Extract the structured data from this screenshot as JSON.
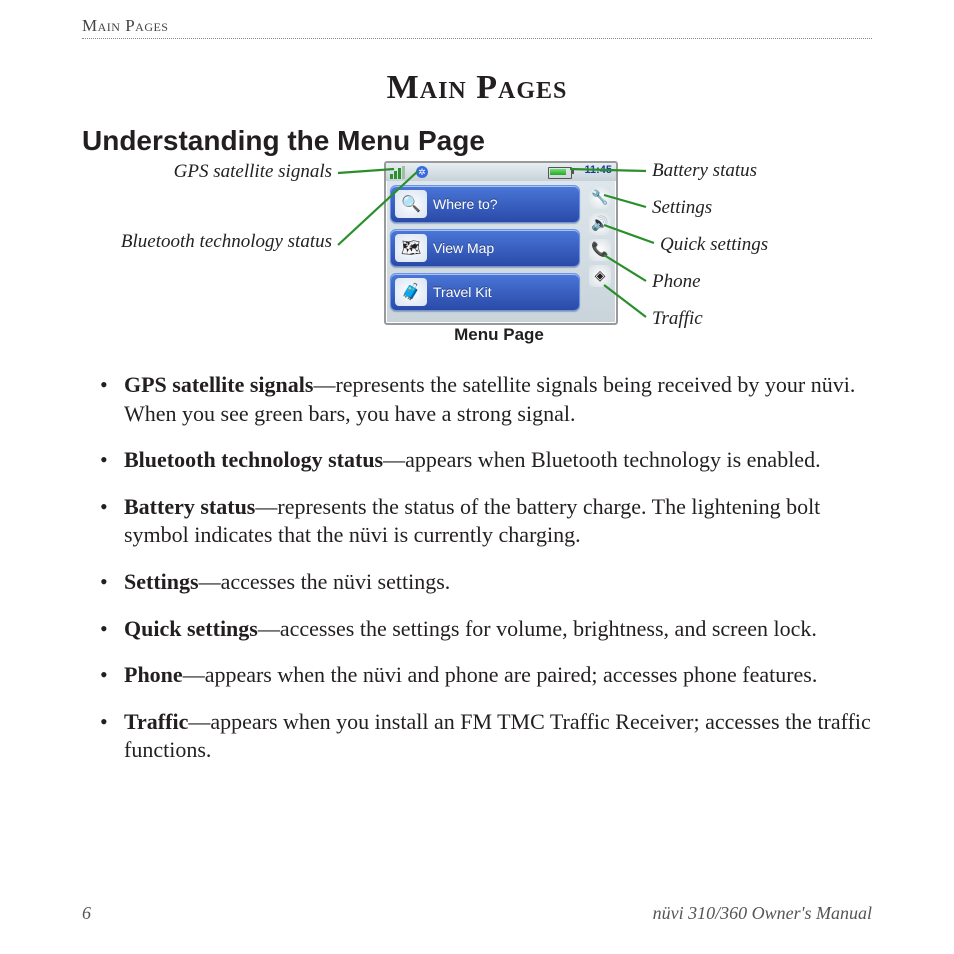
{
  "header": {
    "running_head": "Main Pages",
    "title": "Main Pages",
    "subtitle": "Understanding the Menu Page"
  },
  "footer": {
    "page_number": "6",
    "manual_title": "nüvi 310/360 Owner's Manual"
  },
  "diagram": {
    "caption": "Menu Page",
    "clock": "11:45",
    "buttons": [
      {
        "label": "Where to?"
      },
      {
        "label": "View Map"
      },
      {
        "label": "Travel Kit"
      }
    ],
    "callouts_left": [
      {
        "text": "GPS satellite signals"
      },
      {
        "text": "Bluetooth technology status"
      }
    ],
    "callouts_right": [
      {
        "text": "Battery status"
      },
      {
        "text": "Settings"
      },
      {
        "text": "Quick settings"
      },
      {
        "text": "Phone"
      },
      {
        "text": "Traffic"
      }
    ]
  },
  "definitions": [
    {
      "term": "GPS satellite signals",
      "dash": "—",
      "desc": "represents the satellite signals being received by your nüvi. When you see green bars, you have a strong signal."
    },
    {
      "term": "Bluetooth technology status",
      "dash": "—",
      "desc": "appears when Bluetooth technology is enabled."
    },
    {
      "term": "Battery status",
      "dash": "—",
      "desc": "represents the status of the battery charge. The lightening bolt symbol indicates that the nüvi is currently charging."
    },
    {
      "term": "Settings",
      "dash": "—",
      "desc": "accesses the nüvi settings."
    },
    {
      "term": "Quick settings",
      "dash": "—",
      "desc": "accesses the settings for volume, brightness, and screen lock."
    },
    {
      "term": "Phone",
      "dash": "—",
      "desc": "appears when the nüvi and phone are paired; accesses phone features."
    },
    {
      "term": "Traffic",
      "dash": "—",
      "desc": "appears when you install an FM TMC Traffic Receiver; accesses the traffic functions."
    }
  ]
}
